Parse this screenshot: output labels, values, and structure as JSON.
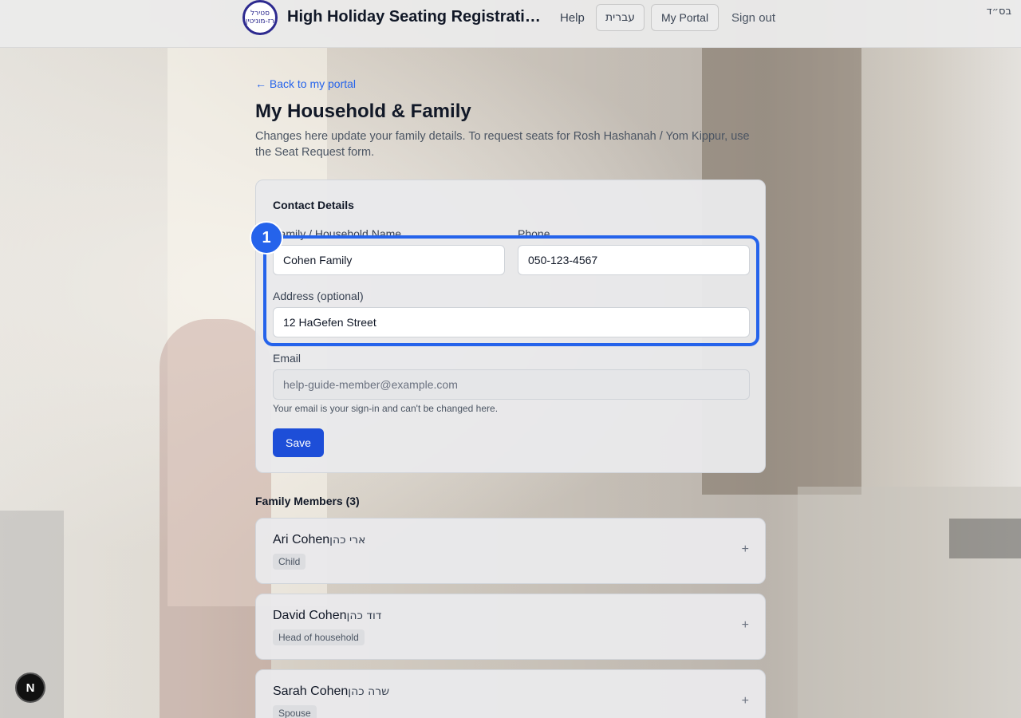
{
  "header": {
    "logo_text": "סטירל רז-מוניטין",
    "app_title": "High Holiday Seating Registration",
    "help_label": "Help",
    "hebrew_label": "עברית",
    "portal_label": "My Portal",
    "signout_label": "Sign out",
    "bsd": "בס״ד"
  },
  "page": {
    "back_link": "← Back to my portal",
    "title": "My Household & Family",
    "description": "Changes here update your family details. To request seats for Rosh Hashanah / Yom Kippur, use the Seat Request form."
  },
  "contact": {
    "section_title": "Contact Details",
    "family_name_label": "Family / Household Name",
    "family_name_value": "Cohen Family",
    "phone_label": "Phone",
    "phone_value": "050-123-4567",
    "address_label": "Address (optional)",
    "address_value": "12 HaGefen Street",
    "email_label": "Email",
    "email_value": "help-guide-member@example.com",
    "email_hint": "Your email is your sign-in and can't be changed here.",
    "save_label": "Save"
  },
  "guide": {
    "step_number": "1"
  },
  "members": {
    "title": "Family Members (3)",
    "items": [
      {
        "name": "Ari Cohen",
        "hebrew": "ארי כהן",
        "role": "Child",
        "toggle": "+"
      },
      {
        "name": "David Cohen",
        "hebrew": "דוד כהן",
        "role": "Head of household",
        "toggle": "+"
      },
      {
        "name": "Sarah Cohen",
        "hebrew": "שרה כהן",
        "role": "Spouse",
        "toggle": "+"
      }
    ]
  },
  "devtools": {
    "badge": "N"
  },
  "colors": {
    "accent": "#2563eb",
    "save_button": "#1d4ed8",
    "logo": "#2d2a8f"
  }
}
